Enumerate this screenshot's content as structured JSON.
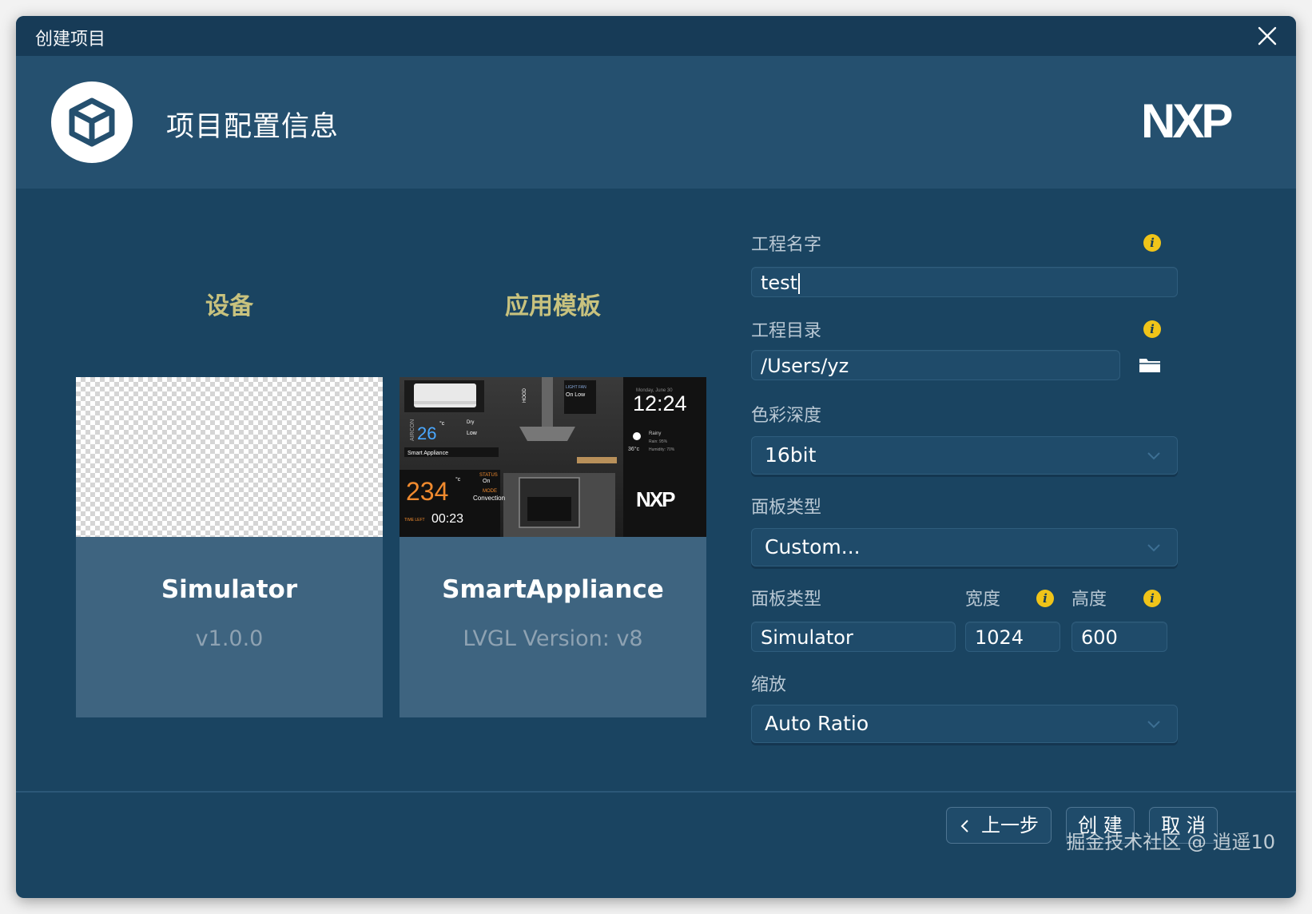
{
  "window": {
    "title": "创建项目"
  },
  "header": {
    "heading": "项目配置信息",
    "brand": "NXP"
  },
  "sections": {
    "device": "设备",
    "template": "应用模板"
  },
  "cards": [
    {
      "name": "Simulator",
      "sub": "v1.0.0"
    },
    {
      "name": "SmartAppliance",
      "sub": "LVGL Version: v8"
    }
  ],
  "template_preview": {
    "temp": "26",
    "temp_unit": "°c",
    "airco_label": "AIRCON",
    "light_fan": "LIGHT  FAN",
    "on_low": "On  Low",
    "mode_dry": "Dry",
    "fan_low": "Low",
    "hood": "HOOD",
    "time": "12:24",
    "date": "Monday, June 30",
    "weather": "Rainy",
    "rain": "Rain: 95%",
    "humidity": "Humidity: 70%",
    "outdoor": "36°c",
    "brand_small": "Smart Appliance",
    "oven_temp": "234",
    "oven_unit": "°c",
    "status_label": "STATUS",
    "status_value": "On",
    "mode_label": "MODE",
    "mode_value": "Convection",
    "time_left_label": "TIME LEFT",
    "time_left": "00:23",
    "brand": "NXP"
  },
  "form": {
    "project_name": {
      "label": "工程名字",
      "value": "test"
    },
    "project_dir": {
      "label": "工程目录",
      "value": "/Users/yz"
    },
    "color_depth": {
      "label": "色彩深度",
      "value": "16bit"
    },
    "panel_type": {
      "label": "面板类型",
      "value": "Custom..."
    },
    "panel_type2": {
      "label": "面板类型",
      "value": "Simulator"
    },
    "width": {
      "label": "宽度",
      "value": "1024"
    },
    "height": {
      "label": "高度",
      "value": "600"
    },
    "scale": {
      "label": "缩放",
      "value": "Auto Ratio"
    }
  },
  "buttons": {
    "prev": "上一步",
    "create": "创 建",
    "cancel": "取 消"
  },
  "watermark": "掘金技术社区 @ 逍遥10",
  "colors": {
    "background": "#1a4461",
    "header": "#25506f",
    "accent": "#c8c27e",
    "info": "#f0c419"
  }
}
